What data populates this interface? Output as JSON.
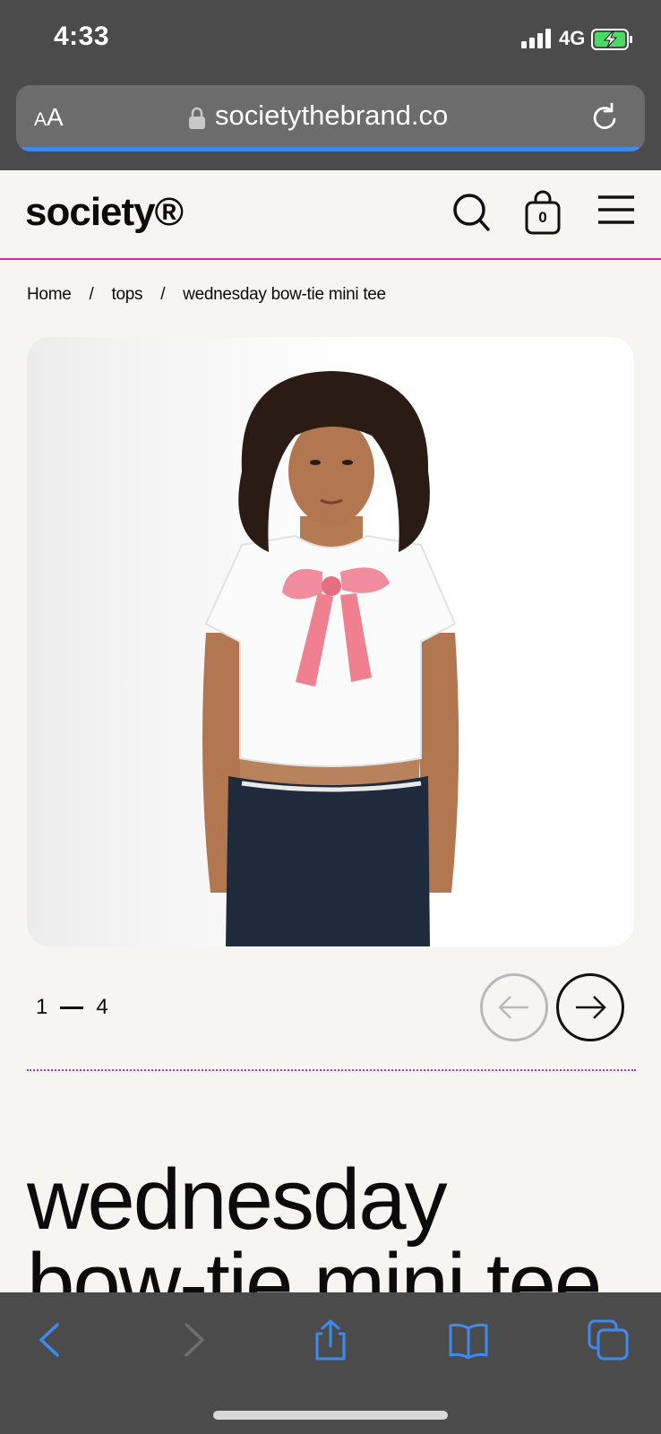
{
  "status": {
    "time": "4:33",
    "network": "4G",
    "signal_icon": "cellular-signal-icon",
    "battery_icon": "battery-charging-icon"
  },
  "browser": {
    "text_size_label_small": "A",
    "text_size_label_large": "A",
    "url": "societythebrand.co",
    "lock_icon": "lock-icon",
    "reload_icon": "reload-icon",
    "progress_color": "#3e8bf0",
    "toolbar": {
      "back_icon": "chevron-left-icon",
      "forward_icon": "chevron-right-icon",
      "share_icon": "share-icon",
      "bookmarks_icon": "book-icon",
      "tabs_icon": "tabs-icon"
    }
  },
  "site": {
    "logo": "society®",
    "accent_color": "#c431a6",
    "cart_count": "0",
    "search_icon": "search-icon",
    "cart_icon": "shopping-bag-icon",
    "menu_icon": "hamburger-menu-icon"
  },
  "breadcrumb": {
    "items": [
      "Home",
      "tops",
      "wednesday bow-tie mini tee"
    ],
    "separator": "/"
  },
  "gallery": {
    "current": "1",
    "total": "4",
    "prev_icon": "arrow-left-icon",
    "next_icon": "arrow-right-icon"
  },
  "product": {
    "title_line1": "wednesday",
    "title_line2": "bow-tie mini tee"
  }
}
